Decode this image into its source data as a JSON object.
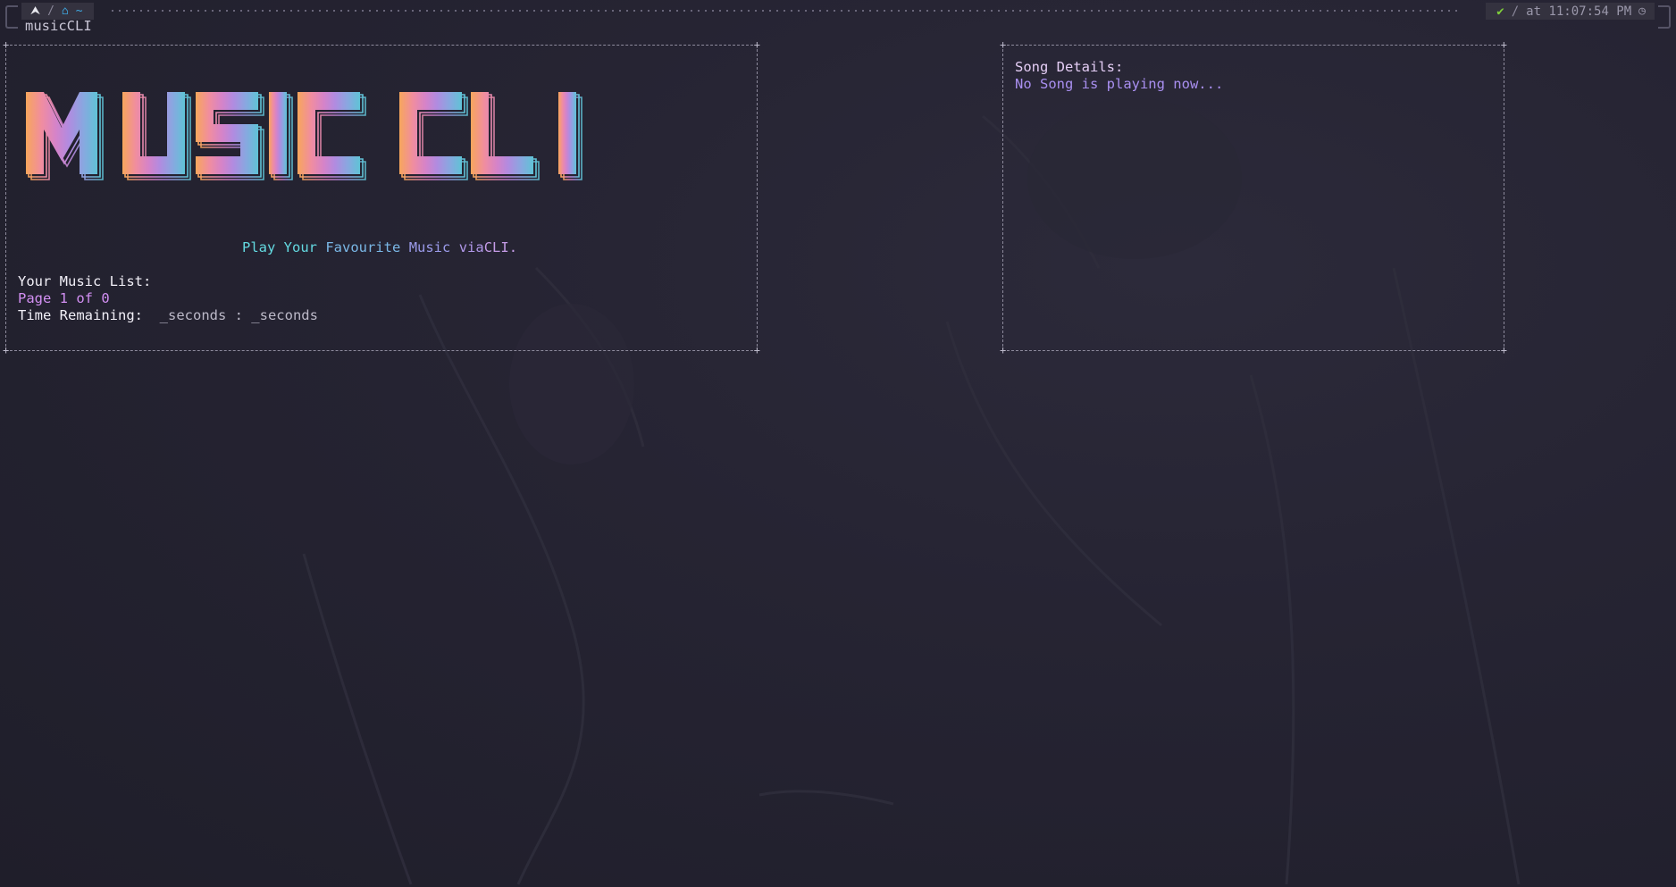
{
  "prompt": {
    "left_icons": [
      "arch-icon",
      "home-icon"
    ],
    "path": "~",
    "status_ok": "✔",
    "time_text": "at 11:07:54 PM"
  },
  "window": {
    "title": "musicCLI"
  },
  "main": {
    "logo_text": "MUSIC CLI",
    "subtitle_words": [
      "Play Your",
      "Favourite",
      "Music",
      "via",
      "CLI."
    ],
    "music_list_label": "Your Music List:",
    "page_info": "Page 1 of 0",
    "time_remaining_label": "Time Remaining:",
    "time_remaining_value": "_seconds : _seconds"
  },
  "details": {
    "label": "Song Details:",
    "status": "No Song is playing now..."
  },
  "colors": {
    "logo_gradient": [
      "#f7a65c",
      "#f08da0",
      "#d583c9",
      "#b18be0",
      "#89a7e0",
      "#5fc3d6"
    ],
    "accent_purple": "#a98ff0",
    "accent_cyan": "#63d9e0"
  }
}
